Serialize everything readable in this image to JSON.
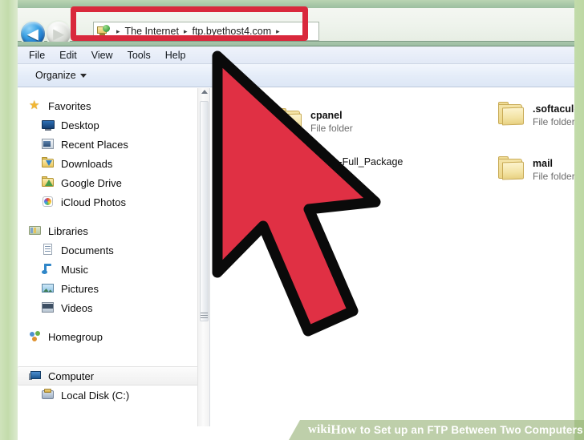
{
  "window": {
    "nav": {
      "back_label": "◀",
      "forward_label": "▶",
      "address": {
        "icon": "network-globe-icon",
        "crumbs": [
          "The Internet",
          "ftp.byethost4.com"
        ],
        "separator": "▸",
        "trailing_separator": "▸"
      }
    },
    "menubar": {
      "items": [
        "File",
        "Edit",
        "View",
        "Tools",
        "Help"
      ]
    },
    "toolbar": {
      "organize_label": "Organize"
    },
    "navpane": {
      "groups": [
        {
          "header": {
            "label": "Favorites",
            "icon": "star-icon"
          },
          "items": [
            {
              "label": "Desktop",
              "icon": "desktop-icon"
            },
            {
              "label": "Recent Places",
              "icon": "recent-places-icon"
            },
            {
              "label": "Downloads",
              "icon": "downloads-folder-icon"
            },
            {
              "label": "Google Drive",
              "icon": "google-drive-icon"
            },
            {
              "label": "iCloud Photos",
              "icon": "icloud-photos-icon"
            }
          ]
        },
        {
          "header": {
            "label": "Libraries",
            "icon": "libraries-icon"
          },
          "items": [
            {
              "label": "Documents",
              "icon": "documents-icon"
            },
            {
              "label": "Music",
              "icon": "music-icon"
            },
            {
              "label": "Pictures",
              "icon": "pictures-icon"
            },
            {
              "label": "Videos",
              "icon": "videos-icon"
            }
          ]
        },
        {
          "header": {
            "label": "Homegroup",
            "icon": "homegroup-icon"
          },
          "items": []
        },
        {
          "header": {
            "label": "Computer",
            "icon": "computer-icon",
            "selected": true
          },
          "items": [
            {
              "label": "Local Disk (C:)",
              "icon": "local-disk-icon"
            }
          ]
        }
      ]
    },
    "filepane": {
      "items": [
        {
          "name": "cpanel",
          "type": "File folder",
          "icon": "folder-icon"
        },
        {
          "name": "Stable-Full_Package",
          "type": "",
          "icon": "folder-icon"
        },
        {
          "name": ".softaculous",
          "type": "File folder",
          "icon": "folder-icon"
        },
        {
          "name": "mail",
          "type": "File folder",
          "icon": "folder-icon"
        }
      ]
    }
  },
  "annotation": {
    "highlight_color": "#d9283c",
    "cursor_color": "#e03044",
    "cursor_outline": "#0a0a0a"
  },
  "watermark": {
    "wiki": "wiki",
    "how": "How",
    "rest": "to Set up an FTP Between Two Computers",
    "full": "wikiHow to Set up an FTP Between Two Computers"
  },
  "theme": {
    "background_green": "#bdd8a4",
    "window_chrome": "#9cbfa0"
  }
}
